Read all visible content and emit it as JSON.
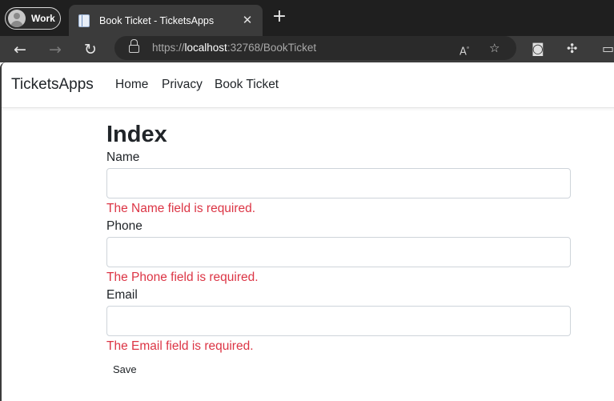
{
  "browser": {
    "profile_label": "Work",
    "tab_title": "Book Ticket - TicketsApps",
    "url_scheme": "https://",
    "url_host": "localhost",
    "url_rest": ":32768/BookTicket"
  },
  "site": {
    "brand": "TicketsApps",
    "nav": [
      "Home",
      "Privacy",
      "Book Ticket"
    ]
  },
  "form": {
    "heading": "Index",
    "fields": [
      {
        "label": "Name",
        "value": "",
        "error": "The Name field is required."
      },
      {
        "label": "Phone",
        "value": "",
        "error": "The Phone field is required."
      },
      {
        "label": "Email",
        "value": "",
        "error": "The Email field is required."
      }
    ],
    "save_label": "Save"
  },
  "colors": {
    "error": "#dc3545",
    "text": "#212529",
    "chrome_dark": "#1f1f1f",
    "chrome_toolbar": "#3b3b3b"
  },
  "icons": [
    "back-icon",
    "forward-icon",
    "refresh-icon",
    "lock-icon",
    "read-aloud-icon",
    "favorite-icon",
    "camera-icon",
    "extensions-icon",
    "split-screen-icon",
    "close-icon",
    "new-tab-icon"
  ]
}
